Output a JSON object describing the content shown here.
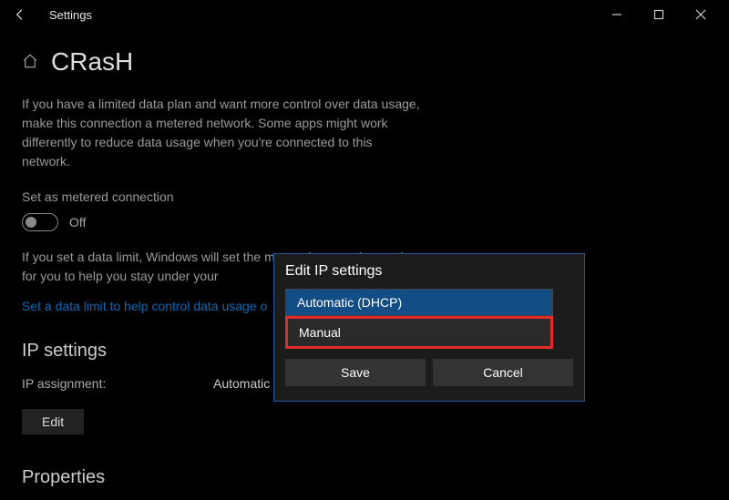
{
  "titlebar": {
    "title": "Settings"
  },
  "page": {
    "title": "CRasH",
    "intro": "If you have a limited data plan and want more control over data usage, make this connection a metered network. Some apps might work differently to reduce data usage when you're connected to this network.",
    "metered_label": "Set as metered connection",
    "toggle_state": "Off",
    "limit_intro": "If you set a data limit, Windows will set the metered connection setting for you to help you stay under your",
    "limit_link": "Set a data limit to help control data usage o",
    "ip_settings_title": "IP settings",
    "ip_assignment_key": "IP assignment:",
    "ip_assignment_val": "Automatic (DHC",
    "edit_label": "Edit",
    "properties_title": "Properties"
  },
  "popup": {
    "title": "Edit IP settings",
    "option_auto": "Automatic (DHCP)",
    "option_manual": "Manual",
    "save": "Save",
    "cancel": "Cancel"
  }
}
